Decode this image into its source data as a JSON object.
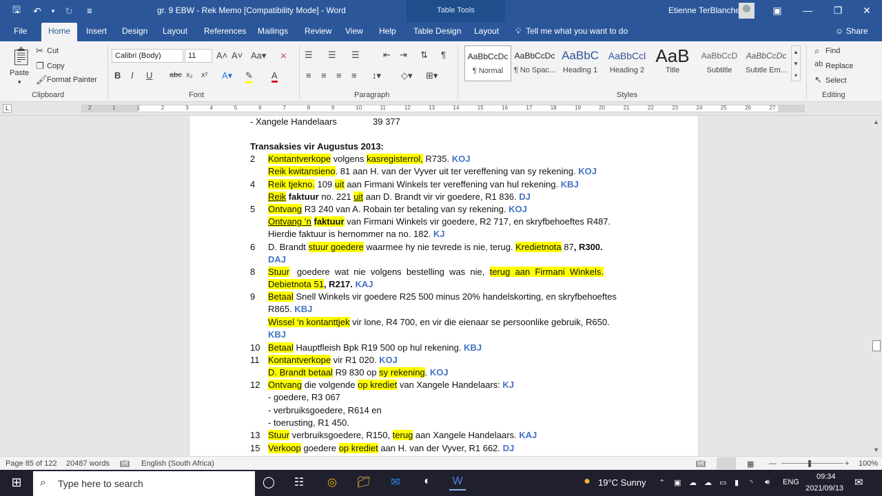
{
  "window": {
    "title": "gr. 9 EBW - Rek Memo [Compatibility Mode] - Word",
    "context_tab": "Table Tools",
    "user": "Etienne TerBlanche"
  },
  "tabs": [
    "File",
    "Home",
    "Insert",
    "Design",
    "Layout",
    "References",
    "Mailings",
    "Review",
    "View",
    "Help",
    "Table Design",
    "Layout"
  ],
  "tell_me": "Tell me what you want to do",
  "share": "Share",
  "ribbon": {
    "clipboard": {
      "label": "Clipboard",
      "paste": "Paste",
      "cut": "Cut",
      "copy": "Copy",
      "format_painter": "Format Painter"
    },
    "font": {
      "label": "Font",
      "family": "Calibri (Body)",
      "size": "11"
    },
    "paragraph": {
      "label": "Paragraph"
    },
    "styles": {
      "label": "Styles",
      "items": [
        {
          "preview": "AaBbCcDc",
          "name": "¶ Normal"
        },
        {
          "preview": "AaBbCcDc",
          "name": "¶ No Spac..."
        },
        {
          "preview": "AaBbC",
          "name": "Heading 1"
        },
        {
          "preview": "AaBbCcl",
          "name": "Heading 2"
        },
        {
          "preview": "AaB",
          "name": "Title"
        },
        {
          "preview": "AaBbCcD",
          "name": "Subtitle"
        },
        {
          "preview": "AaBbCcDc",
          "name": "Subtle Em..."
        }
      ]
    },
    "editing": {
      "label": "Editing",
      "find": "Find",
      "replace": "Replace",
      "select": "Select"
    }
  },
  "ruler": {
    "numbers": [
      "2",
      "1",
      "1",
      "2",
      "3",
      "4",
      "5",
      "6",
      "7",
      "8",
      "9",
      "10",
      "11",
      "12",
      "13",
      "14",
      "15",
      "16",
      "17",
      "18",
      "19",
      "20",
      "21",
      "22",
      "23",
      "24",
      "25",
      "26",
      "27"
    ]
  },
  "document": {
    "xangele_line": "- Xangele Handelaars",
    "xangele_value": "39 377",
    "heading": "Transaksies vir Augustus 2013:"
  },
  "status": {
    "page": "Page 85 of 122",
    "words": "20487 words",
    "language": "English (South Africa)",
    "zoom": "100%"
  },
  "taskbar": {
    "search_placeholder": "Type here to search",
    "weather": "19°C  Sunny",
    "lang": "ENG",
    "time": "09:34",
    "date": "2021/09/13"
  }
}
